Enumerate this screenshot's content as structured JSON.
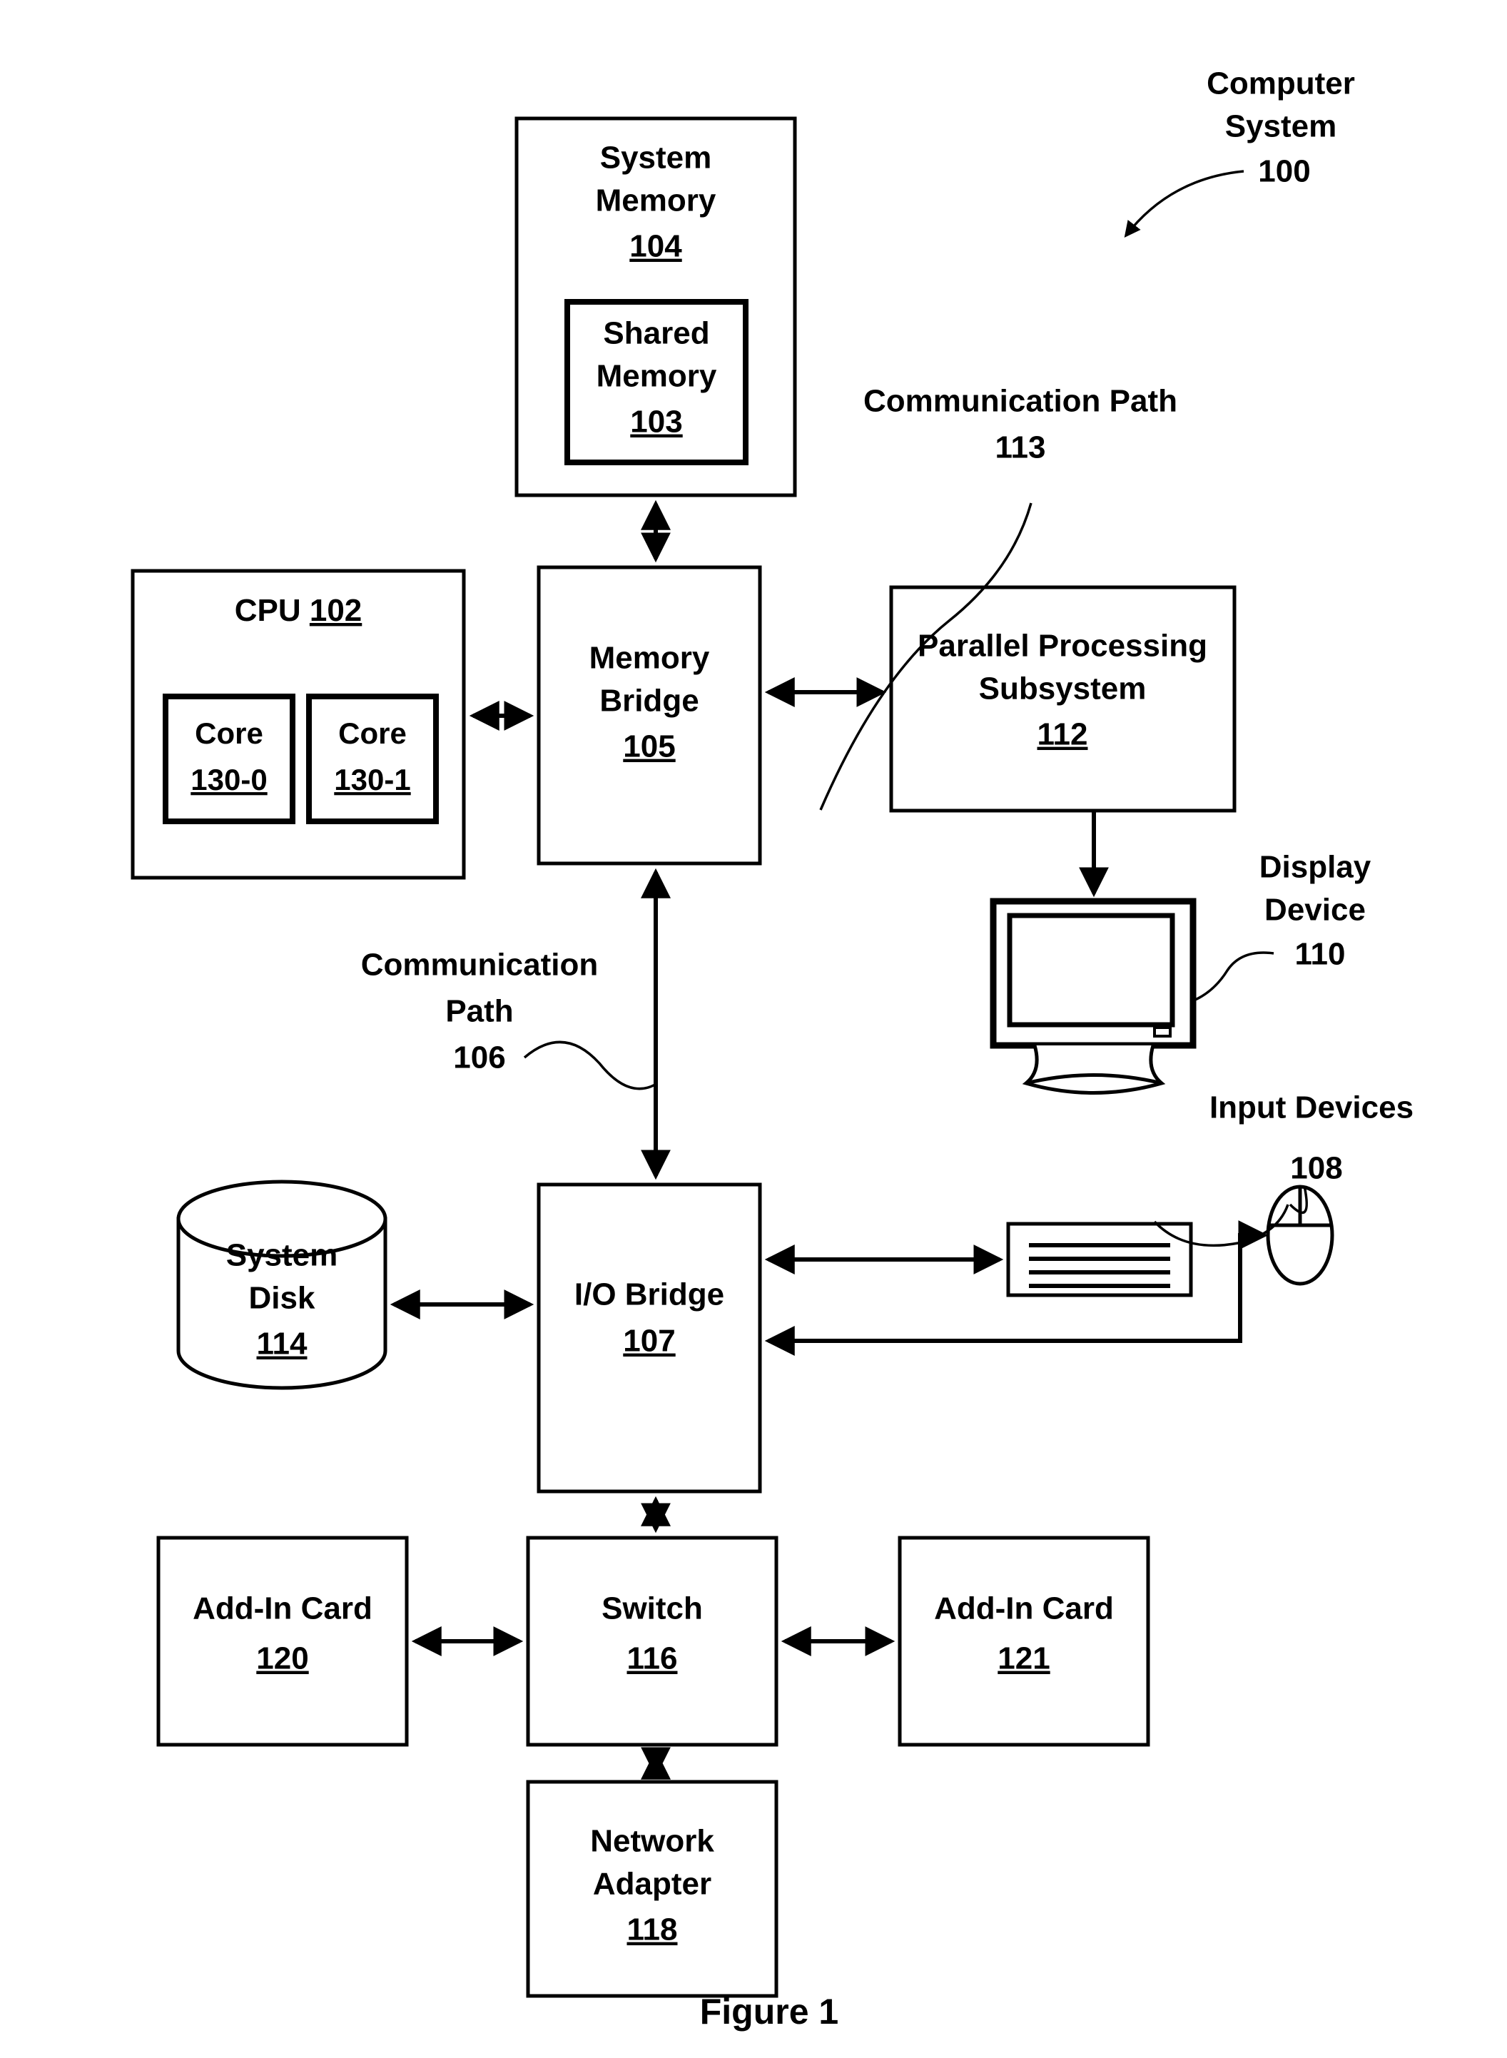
{
  "figure": {
    "caption": "Figure 1",
    "title_annotation": {
      "line1": "Computer",
      "line2": "System",
      "ref": "100"
    }
  },
  "blocks": {
    "system_memory": {
      "line1": "System",
      "line2": "Memory",
      "ref": "104"
    },
    "shared_memory": {
      "line1": "Shared",
      "line2": "Memory",
      "ref": "103"
    },
    "cpu": {
      "label": "CPU",
      "ref": "102"
    },
    "core_0": {
      "label": "Core",
      "ref": "130-0"
    },
    "core_1": {
      "label": "Core",
      "ref": "130-1"
    },
    "memory_bridge": {
      "line1": "Memory",
      "line2": "Bridge",
      "ref": "105"
    },
    "parallel_processing_subsystem": {
      "line1": "Parallel Processing",
      "line2": "Subsystem",
      "ref": "112"
    },
    "io_bridge": {
      "label": "I/O Bridge",
      "ref": "107"
    },
    "system_disk": {
      "line1": "System",
      "line2": "Disk",
      "ref": "114"
    },
    "switch": {
      "label": "Switch",
      "ref": "116"
    },
    "add_in_card_120": {
      "label": "Add-In Card",
      "ref": "120"
    },
    "add_in_card_121": {
      "label": "Add-In Card",
      "ref": "121"
    },
    "network_adapter": {
      "line1": "Network",
      "line2": "Adapter",
      "ref": "118"
    }
  },
  "annotations": {
    "communication_path_113": {
      "line1": "Communication Path",
      "ref": "113"
    },
    "communication_path_106": {
      "line1": "Communication",
      "line2": "Path",
      "ref": "106"
    },
    "display_device": {
      "line1": "Display",
      "line2": "Device",
      "ref": "110"
    },
    "input_devices": {
      "line1": "Input Devices",
      "ref": "108"
    }
  },
  "colors": {
    "ink": "#000000",
    "paper": "#ffffff"
  }
}
